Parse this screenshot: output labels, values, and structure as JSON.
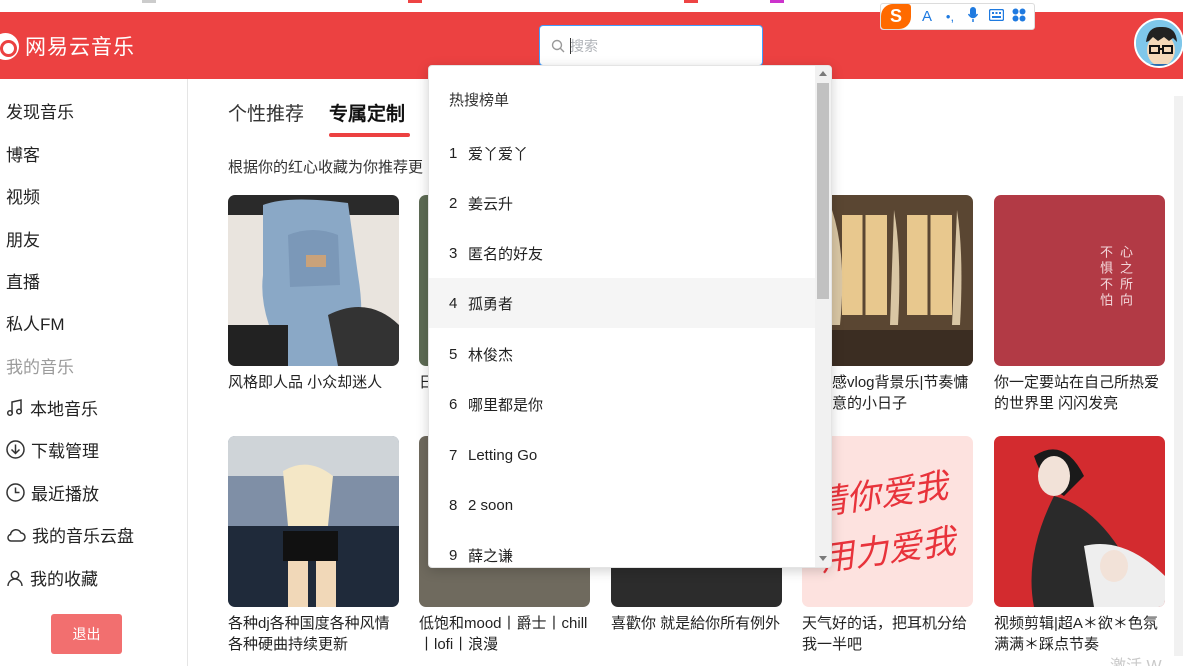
{
  "app": {
    "logo_text": "网易云音乐"
  },
  "search": {
    "placeholder": "搜索",
    "value": ""
  },
  "ime": {
    "logo": "S",
    "items": [
      "A",
      "•,",
      "mic-icon",
      "keyboard-icon",
      "grid-icon"
    ]
  },
  "sidebar": {
    "items": [
      {
        "label": "发现音乐"
      },
      {
        "label": "博客"
      },
      {
        "label": "视频"
      },
      {
        "label": "朋友"
      },
      {
        "label": "直播"
      },
      {
        "label": "私人FM"
      }
    ],
    "section_label": "我的音乐",
    "my_items": [
      {
        "label": "本地音乐",
        "icon": "music-note-icon"
      },
      {
        "label": "下载管理",
        "icon": "download-icon"
      },
      {
        "label": "最近播放",
        "icon": "clock-icon"
      },
      {
        "label": "我的音乐云盘",
        "icon": "cloud-icon"
      },
      {
        "label": "我的收藏",
        "icon": "user-icon"
      }
    ],
    "logout_label": "退出"
  },
  "tabs": [
    {
      "label": "个性推荐"
    },
    {
      "label": "专属定制",
      "active": true
    }
  ],
  "intro": "根据你的红心收藏为你推荐更",
  "playlists": [
    {
      "title": "风格即人品 小众却迷人"
    },
    {
      "title": "日"
    },
    {
      "title": ""
    },
    {
      "title": "氛围感vlog背景乐|节奏慵懒惬意的小日子"
    },
    {
      "title": "你一定要站在自己所热爱的世界里 闪闪发亮",
      "cover_text": "心之所向 不惧不怕"
    },
    {
      "title": "各种dj各种国度各种风情各种硬曲持续更新"
    },
    {
      "title": "低饱和mood丨爵士丨chill丨lofi丨浪漫"
    },
    {
      "title": "喜歡你 就是給你所有例外"
    },
    {
      "title": "天气好的话，把耳机分给我一半吧",
      "cover_text": "请你爱我 用力爱我"
    },
    {
      "title": "视频剪辑|超A＊欲＊色氛满满＊踩点节奏"
    }
  ],
  "dropdown": {
    "heading": "热搜榜单",
    "items": [
      {
        "rank": "1",
        "name": "爱丫爱丫"
      },
      {
        "rank": "2",
        "name": "姜云升"
      },
      {
        "rank": "3",
        "name": "匿名的好友"
      },
      {
        "rank": "4",
        "name": "孤勇者"
      },
      {
        "rank": "5",
        "name": "林俊杰"
      },
      {
        "rank": "6",
        "name": "哪里都是你"
      },
      {
        "rank": "7",
        "name": "Letting Go"
      },
      {
        "rank": "8",
        "name": "2 soon"
      },
      {
        "rank": "9",
        "name": "薛之谦"
      }
    ]
  },
  "watermark": "激活 W",
  "colors": {
    "brand": "#ec4141",
    "logout_button": "#f26f6f",
    "search_border": "#409eff"
  }
}
